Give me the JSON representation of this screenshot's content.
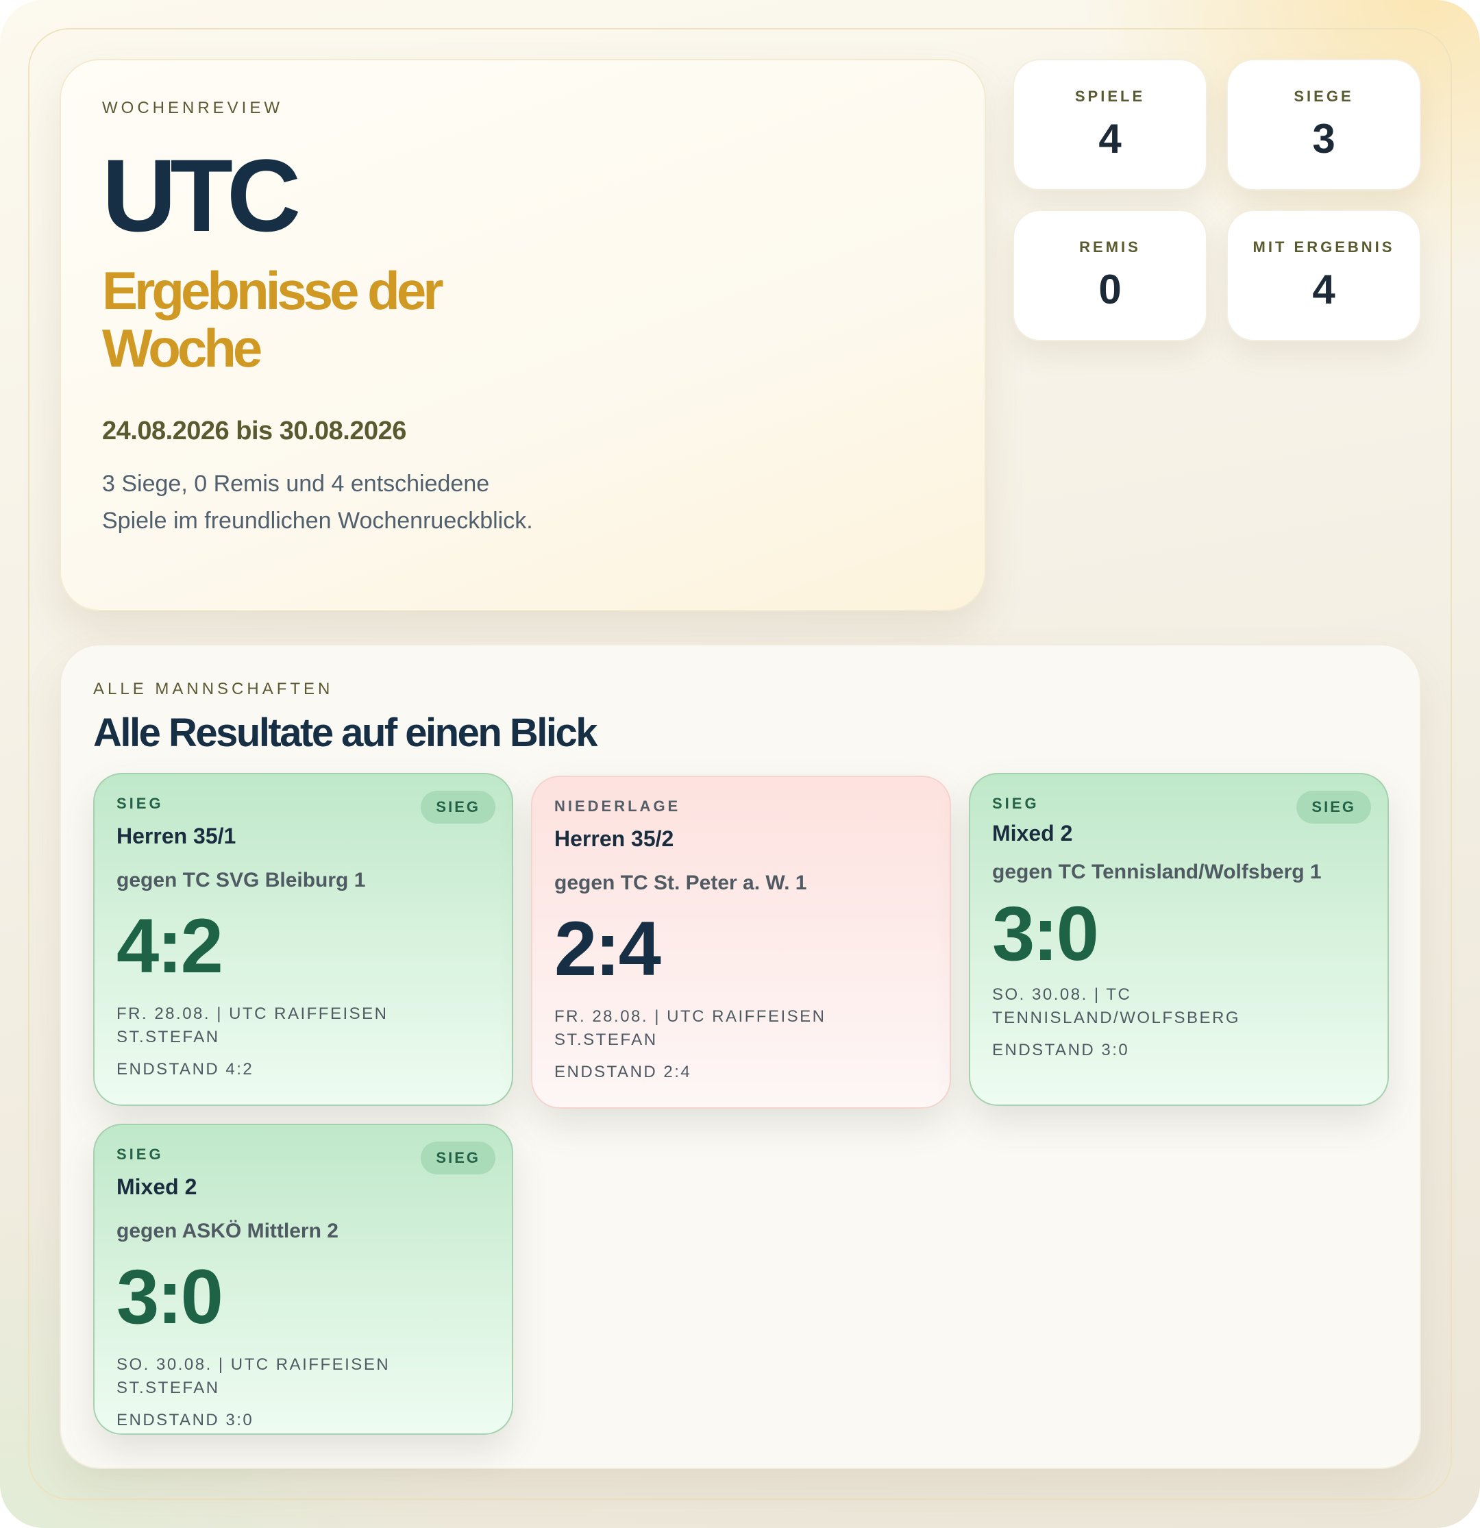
{
  "hero": {
    "eyebrow": "WOCHENREVIEW",
    "title": "UTC",
    "subtitle": "Ergebnisse der Woche",
    "date_range": "24.08.2026 bis 30.08.2026",
    "description": "3 Siege, 0 Remis und 4 entschiedene Spiele im freundlichen Wochenrueckblick."
  },
  "stats": [
    {
      "label": "SPIELE",
      "value": "4"
    },
    {
      "label": "SIEGE",
      "value": "3"
    },
    {
      "label": "REMIS",
      "value": "0"
    },
    {
      "label": "MIT ERGEBNIS",
      "value": "4"
    }
  ],
  "results": {
    "eyebrow": "ALLE MANNSCHAFTEN",
    "title": "Alle Resultate auf einen Blick",
    "cards": [
      {
        "status": "SIEG",
        "badge": "SIEG",
        "team": "Herren 35/1",
        "opponent": "gegen TC SVG Bleiburg 1",
        "score": "4:2",
        "meta": "FR. 28.08. | UTC RAIFFEISEN ST.STEFAN",
        "final": "ENDSTAND 4:2"
      },
      {
        "status": "NIEDERLAGE",
        "team": "Herren 35/2",
        "opponent": "gegen TC St. Peter a. W. 1",
        "score": "2:4",
        "meta": "FR. 28.08. | UTC RAIFFEISEN ST.STEFAN",
        "final": "ENDSTAND 2:4"
      },
      {
        "status": "SIEG",
        "badge": "SIEG",
        "team": "Mixed 2",
        "opponent": "gegen TC Tennisland/Wolfsberg 1",
        "score": "3:0",
        "meta": "SO. 30.08. | TC TENNISLAND/WOLFSBERG",
        "final": "ENDSTAND 3:0"
      },
      {
        "status": "SIEG",
        "badge": "SIEG",
        "team": "Mixed 2",
        "opponent": "gegen ASKÖ Mittlern 2",
        "score": "3:0",
        "meta": "SO. 30.08. | UTC RAIFFEISEN ST.STEFAN",
        "final": "ENDSTAND 3:0"
      }
    ]
  },
  "colors": {
    "accent_gold": "#d09923",
    "navy": "#172f45",
    "win_green": "#1e6346",
    "loss_pink": "#fde2df"
  }
}
